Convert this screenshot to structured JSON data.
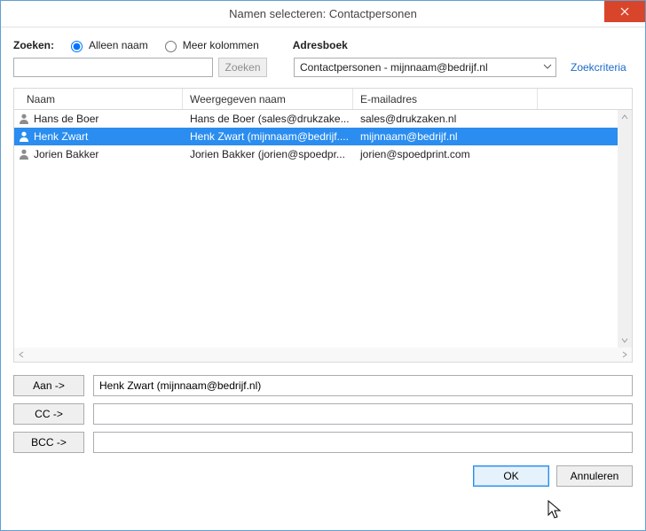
{
  "window": {
    "title": "Namen selecteren: Contactpersonen"
  },
  "search": {
    "label": "Zoeken:",
    "radio_name_only": "Alleen naam",
    "radio_more_cols": "Meer kolommen",
    "value": "",
    "button": "Zoeken"
  },
  "addressbook": {
    "label": "Adresboek",
    "selected": "Contactpersonen - mijnnaam@bedrijf.nl",
    "criteria_link": "Zoekcriteria"
  },
  "columns": {
    "name": "Naam",
    "display": "Weergegeven naam",
    "email": "E-mailadres"
  },
  "contacts": [
    {
      "name": "Hans de Boer",
      "display": "Hans de Boer (sales@drukzake...",
      "email": "sales@drukzaken.nl",
      "selected": false
    },
    {
      "name": "Henk Zwart",
      "display": "Henk Zwart (mijnnaam@bedrijf....",
      "email": "mijnnaam@bedrijf.nl",
      "selected": true
    },
    {
      "name": "Jorien Bakker",
      "display": "Jorien Bakker (jorien@spoedpr...",
      "email": "jorien@spoedprint.com",
      "selected": false
    }
  ],
  "recipients": {
    "to_label": "Aan ->",
    "cc_label": "CC ->",
    "bcc_label": "BCC ->",
    "to_value": "Henk Zwart (mijnnaam@bedrijf.nl)",
    "cc_value": "",
    "bcc_value": ""
  },
  "buttons": {
    "ok": "OK",
    "cancel": "Annuleren"
  }
}
